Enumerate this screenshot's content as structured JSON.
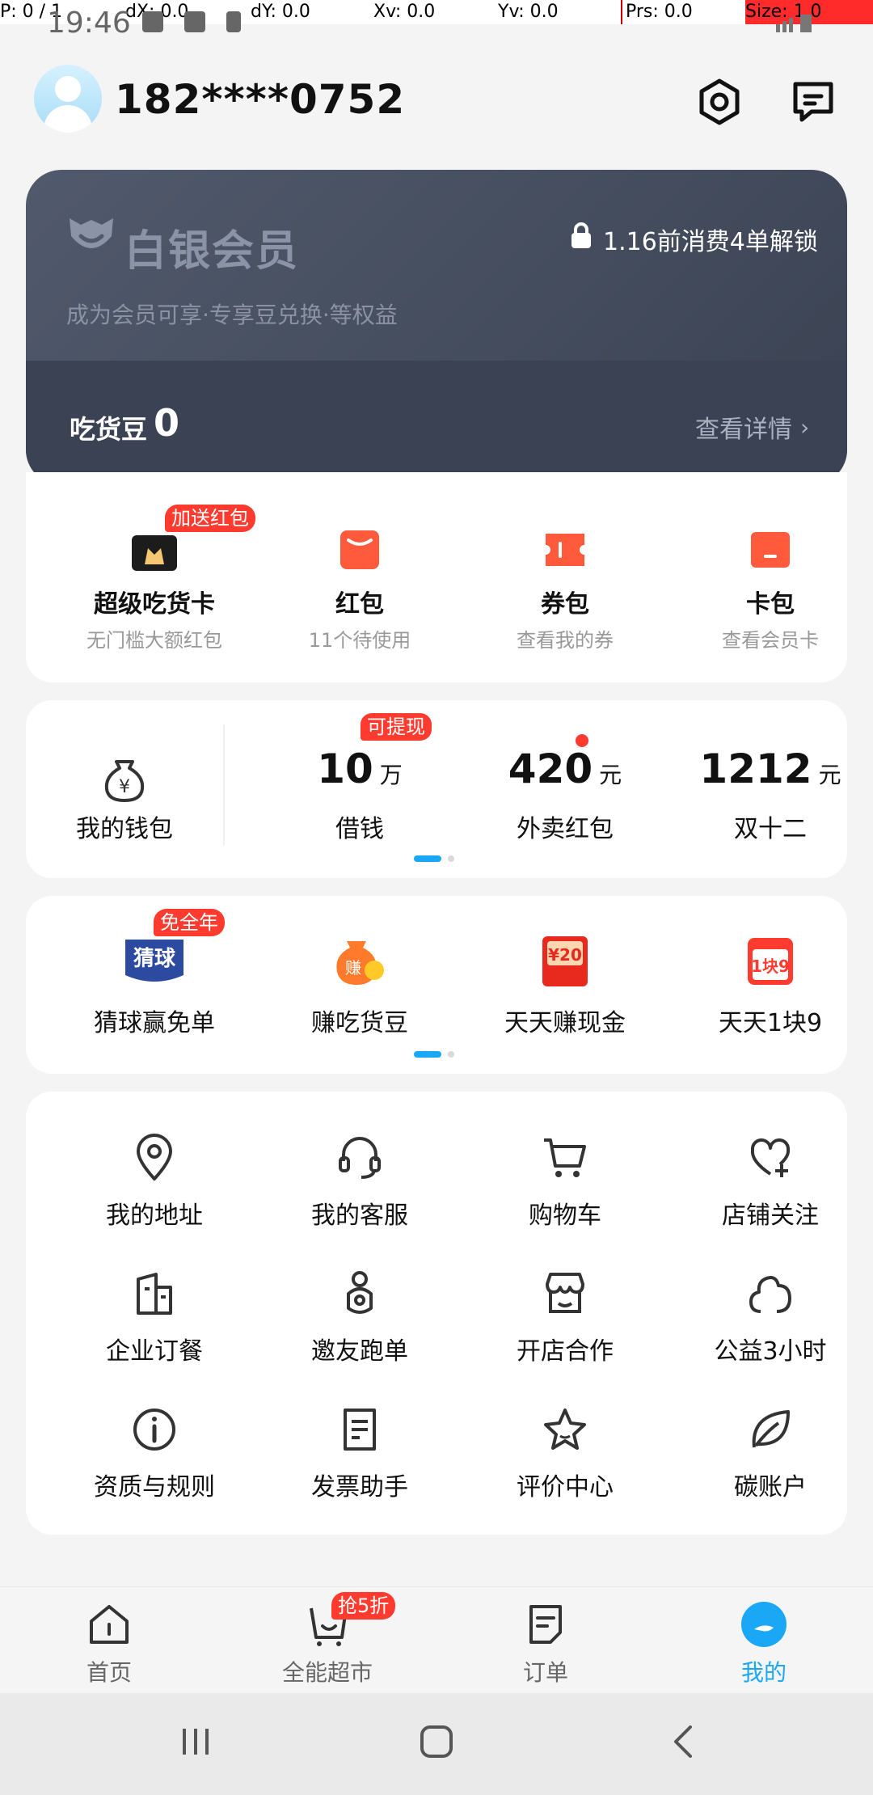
{
  "debug": {
    "p": "P: 0 / 1",
    "dx": "dX: 0.0",
    "dy": "dY: 0.0",
    "xv": "Xv: 0.0",
    "yv": "Yv: 0.0",
    "prs": "Prs: 0.0",
    "size": "Size: 1.0"
  },
  "status": {
    "time": "19:46"
  },
  "header": {
    "phone": "182****0752"
  },
  "member": {
    "title": "白银会员",
    "unlock_text": "1.16前消费4单解锁",
    "subtitle": "成为会员可享·专享豆兑换·等权益",
    "bean_label": "吃货豆",
    "bean_value": "0",
    "detail_label": "查看详情"
  },
  "benefits": [
    {
      "title": "超级吃货卡",
      "sub": "无门槛大额红包",
      "badge": "加送红包",
      "icon": "supercard-icon"
    },
    {
      "title": "红包",
      "sub": "11个待使用",
      "icon": "redpacket-icon"
    },
    {
      "title": "券包",
      "sub": "查看我的券",
      "icon": "coupon-icon"
    },
    {
      "title": "卡包",
      "sub": "查看会员卡",
      "icon": "cardpack-icon"
    }
  ],
  "wallet": {
    "label": "我的钱包",
    "items": [
      {
        "value": "10",
        "unit": "万",
        "label": "借钱",
        "badge": "可提现"
      },
      {
        "value": "420",
        "unit": "元",
        "label": "外卖红包"
      },
      {
        "value": "1212",
        "unit": "元",
        "label": "双十二"
      }
    ]
  },
  "promos": [
    {
      "label": "猜球赢免单",
      "badge": "免全年",
      "icon_text": "猜球"
    },
    {
      "label": "赚吃货豆",
      "icon_text": "赚"
    },
    {
      "label": "天天赚现金",
      "icon_text": "¥20"
    },
    {
      "label": "天天1块9",
      "icon_text": "1块9"
    }
  ],
  "services": [
    {
      "label": "我的地址",
      "icon": "location-icon"
    },
    {
      "label": "我的客服",
      "icon": "headset-icon"
    },
    {
      "label": "购物车",
      "icon": "cart-icon"
    },
    {
      "label": "店铺关注",
      "icon": "heart-plus-icon"
    },
    {
      "label": "企业订餐",
      "icon": "building-icon"
    },
    {
      "label": "邀友跑单",
      "icon": "rider-icon"
    },
    {
      "label": "开店合作",
      "icon": "store-icon"
    },
    {
      "label": "公益3小时",
      "icon": "cloud-icon"
    },
    {
      "label": "资质与规则",
      "icon": "info-icon"
    },
    {
      "label": "发票助手",
      "icon": "invoice-icon"
    },
    {
      "label": "评价中心",
      "icon": "star-icon"
    },
    {
      "label": "碳账户",
      "icon": "leaf-icon"
    }
  ],
  "tabs": [
    {
      "label": "首页",
      "icon": "home-icon"
    },
    {
      "label": "全能超市",
      "icon": "basket-icon",
      "badge": "抢5折"
    },
    {
      "label": "订单",
      "icon": "order-icon"
    },
    {
      "label": "我的",
      "icon": "profile-icon"
    }
  ],
  "colors": {
    "accent": "#1aa7f5",
    "badge": "#ff3b2f",
    "card_dark": "#3b4253"
  }
}
